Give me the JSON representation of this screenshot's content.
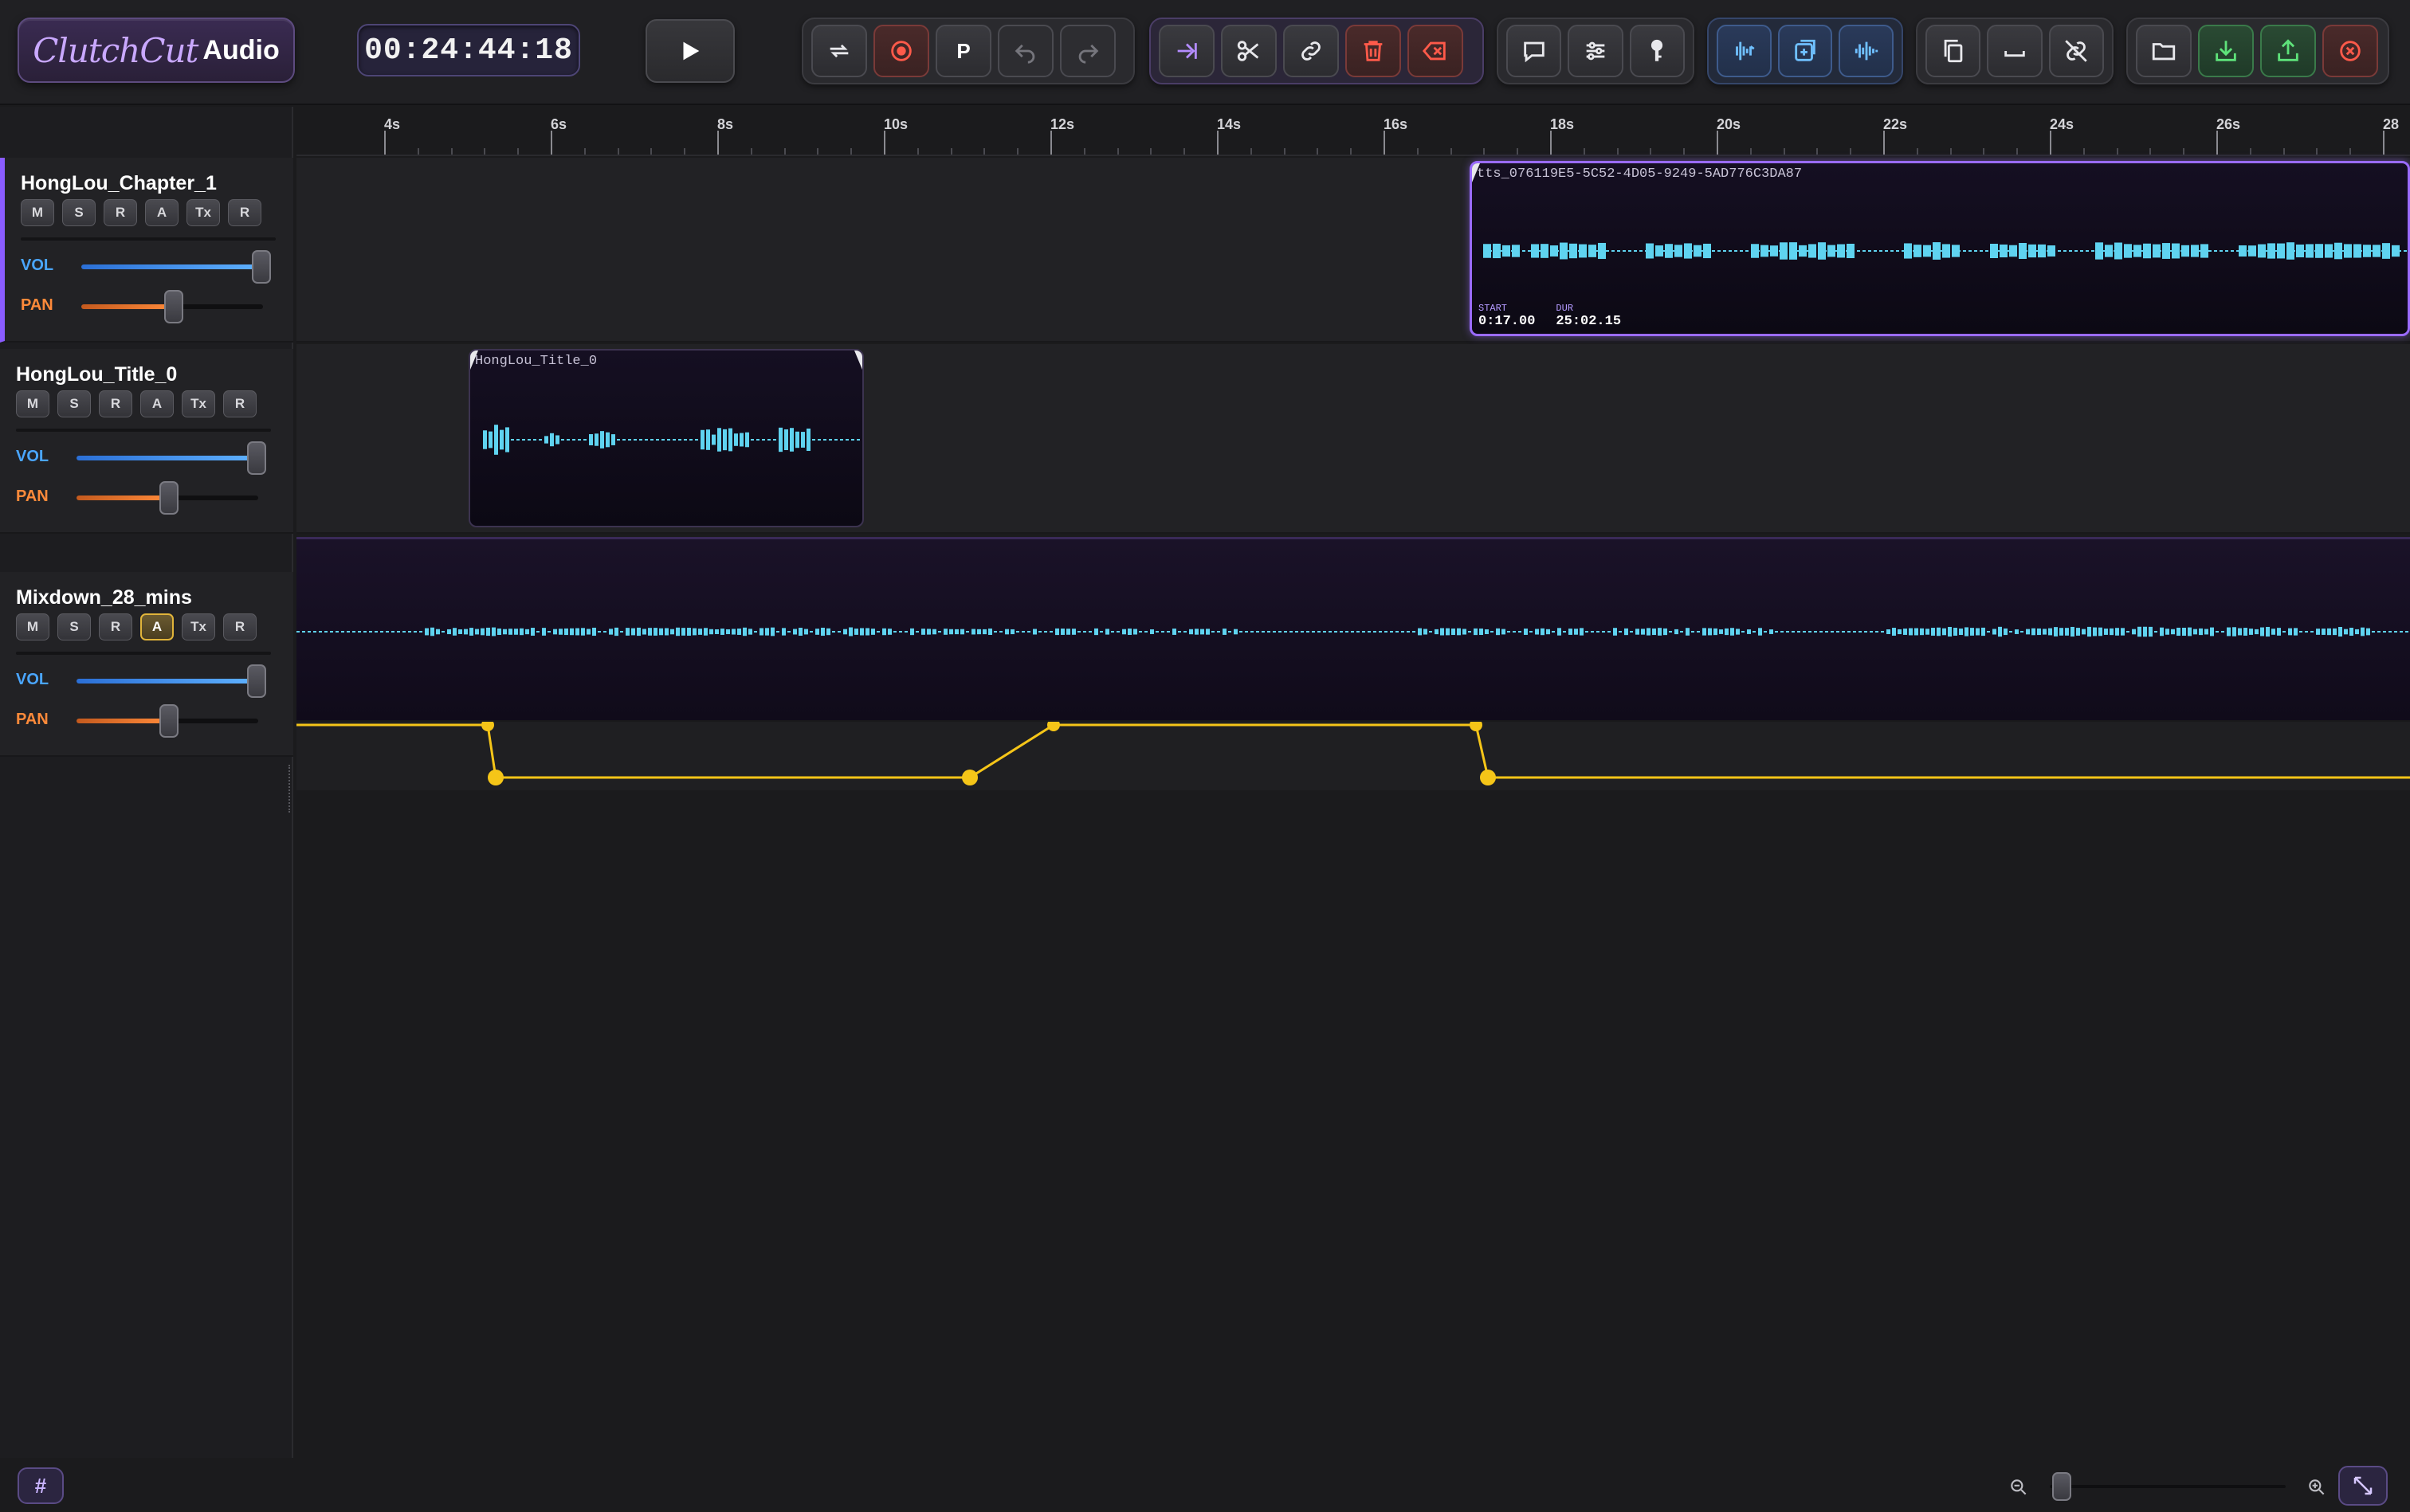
{
  "app": {
    "logo_script": "ClutchCut",
    "logo_word": "Audio"
  },
  "transport": {
    "timecode": "00:24:44:18"
  },
  "toolbar": {
    "groups": [
      {
        "name": "transport",
        "buttons": [
          {
            "icon": "loop-icon"
          },
          {
            "icon": "record-icon"
          },
          {
            "icon": "punch-icon",
            "label": "P"
          },
          {
            "icon": "undo-icon"
          },
          {
            "icon": "redo-icon"
          }
        ]
      },
      {
        "name": "edit",
        "buttons": [
          {
            "icon": "jump-to-end-icon"
          },
          {
            "icon": "scissors-icon"
          },
          {
            "icon": "link-icon"
          },
          {
            "icon": "trash-icon"
          },
          {
            "icon": "backspace-icon"
          }
        ]
      },
      {
        "name": "tools",
        "buttons": [
          {
            "icon": "comment-icon"
          },
          {
            "icon": "sliders-icon"
          },
          {
            "icon": "key-icon"
          }
        ]
      },
      {
        "name": "audio",
        "buttons": [
          {
            "icon": "waveform-split-icon"
          },
          {
            "icon": "add-layer-icon"
          },
          {
            "icon": "waveform-merge-icon"
          }
        ]
      },
      {
        "name": "clipboard",
        "buttons": [
          {
            "icon": "copy-icon"
          },
          {
            "icon": "space-icon"
          },
          {
            "icon": "unlink-icon"
          }
        ]
      },
      {
        "name": "file",
        "buttons": [
          {
            "icon": "folder-icon"
          },
          {
            "icon": "import-icon"
          },
          {
            "icon": "export-icon"
          },
          {
            "icon": "close-icon"
          }
        ]
      }
    ]
  },
  "ruler": {
    "unit": "s",
    "ticks": [
      "4s",
      "6s",
      "8s",
      "10s",
      "12s",
      "14s",
      "16s",
      "18s",
      "20s",
      "22s",
      "24s",
      "26s",
      "28"
    ]
  },
  "tracks": [
    {
      "name": "HongLou_Chapter_1",
      "buttons": [
        "M",
        "S",
        "R",
        "A",
        "Tx",
        "R"
      ],
      "active_buttons": [],
      "vol_label": "VOL",
      "pan_label": "PAN",
      "volume": 1.0,
      "pan": 0.5,
      "selected": true
    },
    {
      "name": "HongLou_Title_0",
      "buttons": [
        "M",
        "S",
        "R",
        "A",
        "Tx",
        "R"
      ],
      "active_buttons": [],
      "vol_label": "VOL",
      "pan_label": "PAN",
      "volume": 1.0,
      "pan": 0.5,
      "selected": false
    },
    {
      "name": "Mixdown_28_mins",
      "buttons": [
        "M",
        "S",
        "R",
        "A",
        "Tx",
        "R"
      ],
      "active_buttons": [
        "A"
      ],
      "vol_label": "VOL",
      "pan_label": "PAN",
      "volume": 1.0,
      "pan": 0.5,
      "selected": false
    }
  ],
  "clips": {
    "chapter": {
      "name": "tts_076119E5-5C52-4D05-9249-5AD776C3DA87",
      "start_label": "START",
      "start": "0:17.00",
      "dur_label": "DUR",
      "duration": "25:02.15"
    },
    "title": {
      "name": "HongLou_Title_0"
    }
  },
  "zoom": {
    "level": 0.05
  },
  "colors": {
    "accent": "#9a6bff",
    "waveform": "#5fd3f0",
    "automation": "#f5c518",
    "vol": "#4aa6ff",
    "pan": "#ff8a3a"
  }
}
